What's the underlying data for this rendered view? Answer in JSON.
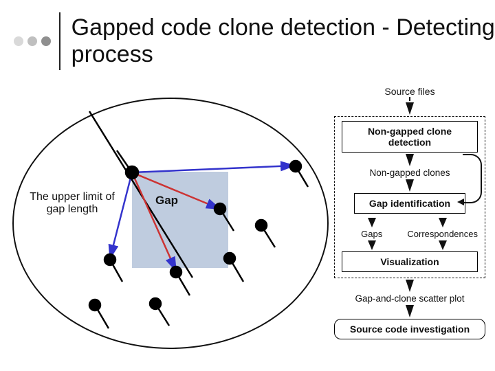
{
  "title": "Gapped code clone detection - Detecting process",
  "left": {
    "upper_limit": "The upper limit of gap length",
    "gap": "Gap"
  },
  "flow": {
    "source_files": "Source files",
    "non_gapped_detection": "Non-gapped clone detection",
    "non_gapped_clones": "Non-gapped clones",
    "gap_identification": "Gap identification",
    "gaps": "Gaps",
    "correspondences": "Correspondences",
    "visualization": "Visualization",
    "scatter_plot": "Gap-and-clone scatter plot",
    "investigation": "Source code investigation"
  }
}
